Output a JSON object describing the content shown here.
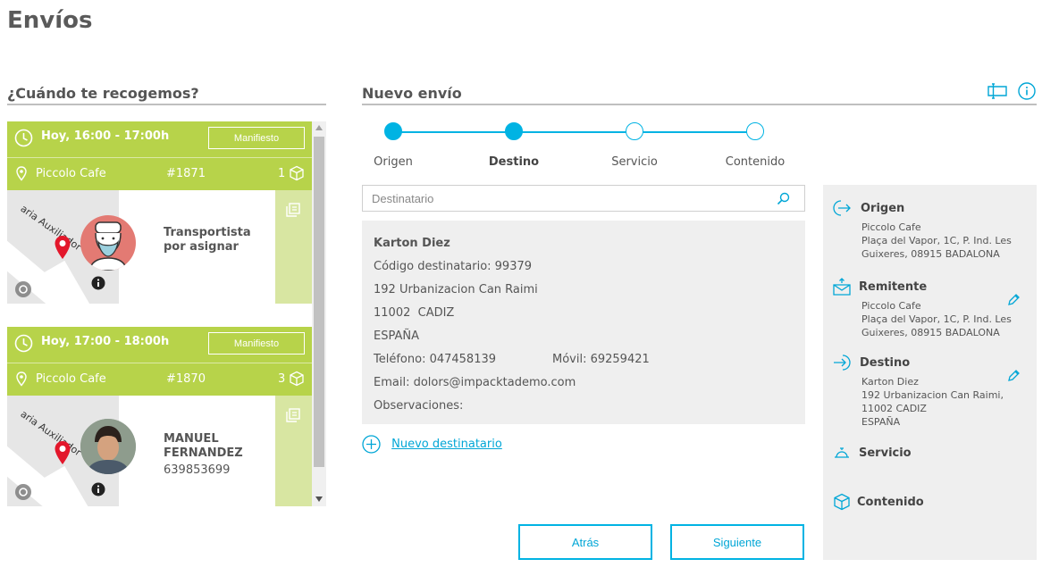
{
  "page": {
    "title": "Envíos"
  },
  "left": {
    "title": "¿Cuándo te recogemos?",
    "pickups": [
      {
        "time": "Hoy, 16:00 - 17:00h",
        "manifest_label": "Manifiesto",
        "place": "Piccolo Cafe",
        "ref": "#1871",
        "count": "1",
        "street": "aria Auxiliador",
        "carrier_line1": "Transportista",
        "carrier_line2": "por asignar",
        "phone": ""
      },
      {
        "time": "Hoy, 17:00 - 18:00h",
        "manifest_label": "Manifiesto",
        "place": "Piccolo Cafe",
        "ref": "#1870",
        "count": "3",
        "street": "aria Auxiliador",
        "carrier_line1": "MANUEL",
        "carrier_line2": "FERNANDEZ",
        "phone": "639853699"
      }
    ]
  },
  "center": {
    "title": "Nuevo envío",
    "steps": [
      {
        "label": "Origen",
        "state": "done"
      },
      {
        "label": "Destino",
        "state": "active"
      },
      {
        "label": "Servicio",
        "state": "todo"
      },
      {
        "label": "Contenido",
        "state": "todo"
      }
    ],
    "search": {
      "placeholder": "Destinatario"
    },
    "recipient": {
      "name": "Karton Diez",
      "code": "Código destinatario: 99379",
      "address": "192 Urbanizacion Can Raimi",
      "city": "11002  CADIZ",
      "country": "ESPAÑA",
      "phone": "Teléfono: 047458139",
      "mobile": "Móvil: 69259421",
      "email": "Email: dolors@impacktademo.com",
      "notes": "Observaciones:"
    },
    "new_recipient_label": "Nuevo destinatario",
    "back_label": "Atrás",
    "next_label": "Siguiente"
  },
  "summary": {
    "origin": {
      "title": "Origen",
      "lines": "Piccolo Cafe\nPlaça del Vapor, 1C, P. Ind. Les Guixeres, 08915 BADALONA"
    },
    "sender": {
      "title": "Remitente",
      "lines": "Piccolo Cafe\nPlaça del Vapor, 1C, P. Ind. Les Guixeres, 08915 BADALONA"
    },
    "destination": {
      "title": "Destino",
      "lines": "Karton Diez\n192 Urbanizacion Can Raimi,\n11002 CADIZ\nESPAÑA"
    },
    "service": {
      "title": "Servicio"
    },
    "content": {
      "title": "Contenido"
    }
  },
  "colors": {
    "accent": "#00b3e3",
    "green": "#b7d34a",
    "panel": "#efefef"
  }
}
